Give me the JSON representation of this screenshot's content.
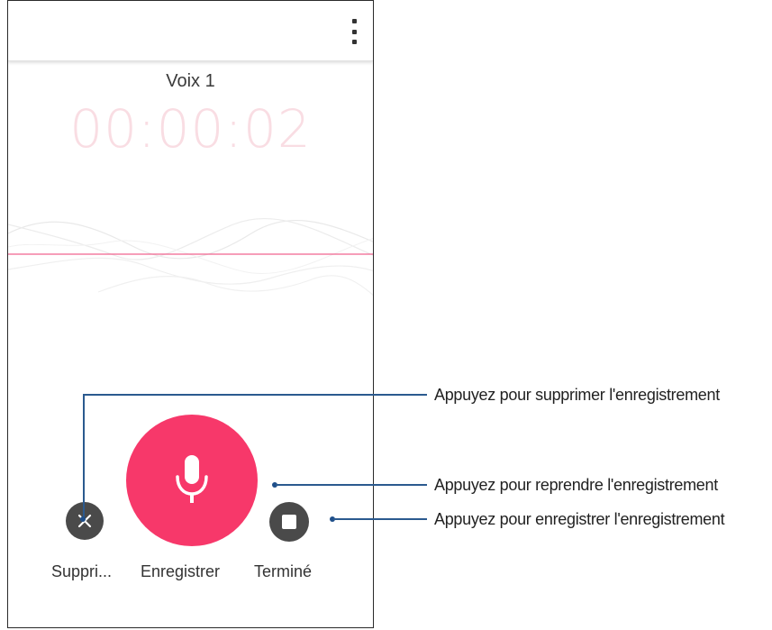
{
  "app": {
    "recording_title": "Voix 1",
    "timer": "00:00:02",
    "menu_icon": "more-vert-icon"
  },
  "controls": {
    "delete_label": "Suppri...",
    "record_label": "Enregistrer",
    "done_label": "Terminé",
    "delete_icon": "close-icon",
    "record_icon": "microphone-icon",
    "done_icon": "stop-icon"
  },
  "callouts": [
    {
      "text": "Appuyez pour supprimer l'enregistrement"
    },
    {
      "text": "Appuyez pour reprendre l'enregistrement"
    },
    {
      "text": "Appuyez pour enregistrer l'enregistrement"
    }
  ],
  "colors": {
    "accent": "#f7386a",
    "timer": "#f9dde3",
    "button_dark": "#4a4a4a",
    "callout": "#2b5a8f"
  }
}
